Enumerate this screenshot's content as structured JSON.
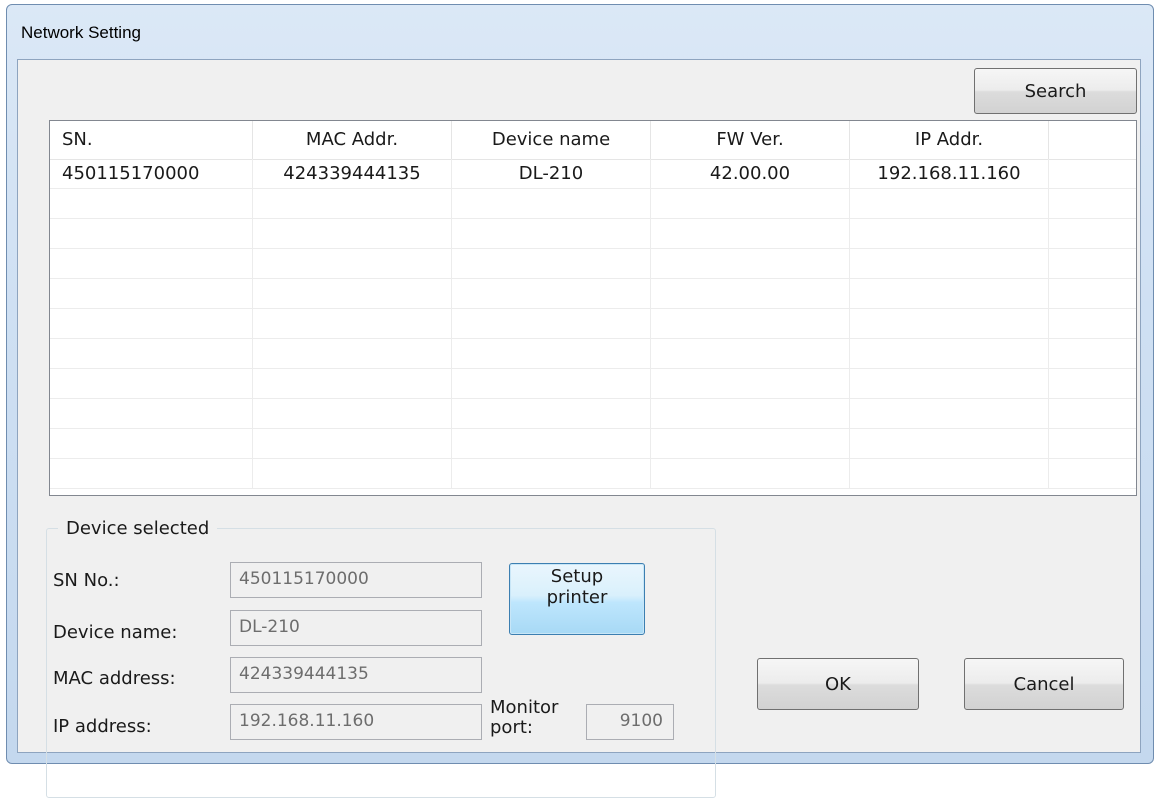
{
  "window": {
    "title": "Network Setting"
  },
  "toolbar": {
    "search_label": "Search"
  },
  "device_list": {
    "columns": [
      "SN.",
      "MAC Addr.",
      "Device name",
      "FW Ver.",
      "IP Addr."
    ],
    "rows": [
      [
        "450115170000",
        "424339444135",
        "DL-210",
        "42.00.00",
        "192.168.11.160"
      ]
    ]
  },
  "device_selected": {
    "legend": "Device selected",
    "sn_label": "SN No.:",
    "sn_value": "450115170000",
    "name_label": "Device name:",
    "name_value": "DL-210",
    "mac_label": "MAC address:",
    "mac_value": "424339444135",
    "ip_label": "IP address:",
    "ip_value": "192.168.11.160",
    "monitor_port_label": "Monitor\nport:",
    "monitor_port_value": "9100",
    "setup_label": "Setup\nprinter"
  },
  "dialog": {
    "ok_label": "OK",
    "cancel_label": "Cancel"
  }
}
